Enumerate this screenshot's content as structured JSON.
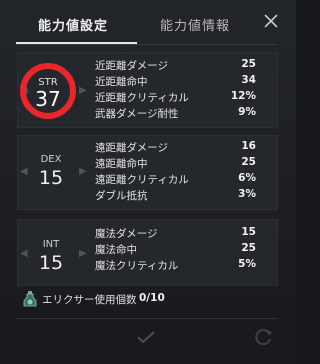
{
  "tabs": [
    {
      "label": "能力値設定",
      "active": true
    },
    {
      "label": "能力値情報",
      "active": false
    }
  ],
  "close_icon": "close-icon",
  "stats": [
    {
      "abbr": "STR",
      "value": "37",
      "highlight_color": "#e8262c",
      "rows": [
        {
          "name": "近距離ダメージ",
          "value": "25"
        },
        {
          "name": "近距離命中",
          "value": "34"
        },
        {
          "name": "近距離クリティカル",
          "value": "12%"
        },
        {
          "name": "武器ダメージ耐性",
          "value": "9%"
        }
      ]
    },
    {
      "abbr": "DEX",
      "value": "15",
      "rows": [
        {
          "name": "遠距離ダメージ",
          "value": "16"
        },
        {
          "name": "遠距離命中",
          "value": "25"
        },
        {
          "name": "遠距離クリティカル",
          "value": "6%"
        },
        {
          "name": "ダブル抵抗",
          "value": "3%"
        }
      ]
    },
    {
      "abbr": "INT",
      "value": "15",
      "rows": [
        {
          "name": "魔法ダメージ",
          "value": "15"
        },
        {
          "name": "魔法命中",
          "value": "25"
        },
        {
          "name": "魔法クリティカル",
          "value": "5%"
        }
      ]
    }
  ],
  "elixir": {
    "label": "エリクサー使用個数",
    "count": "0/10",
    "icon": "elixir-bottle-icon"
  },
  "footer": {
    "confirm_icon": "check-icon",
    "reset_icon": "reset-icon"
  }
}
